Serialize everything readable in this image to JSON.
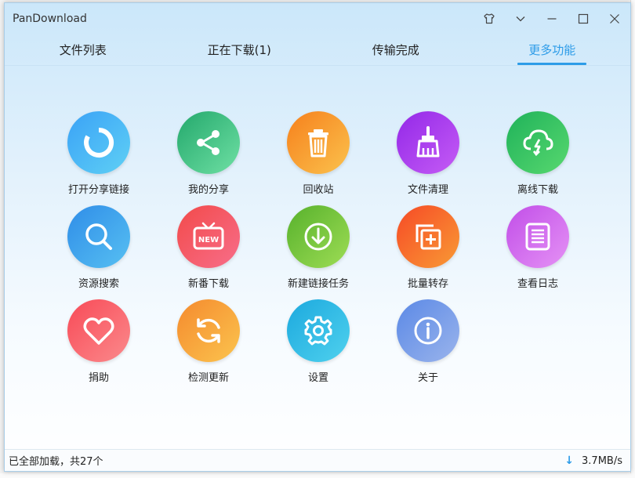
{
  "window": {
    "title": "PanDownload"
  },
  "tabs": [
    {
      "label": "文件列表"
    },
    {
      "label": "正在下载(1)"
    },
    {
      "label": "传输完成"
    },
    {
      "label": "更多功能"
    }
  ],
  "features": [
    {
      "label": "打开分享链接",
      "icon": "circle-arc-icon",
      "color_from": "#3aa2f6",
      "color_to": "#5fd0f5"
    },
    {
      "label": "我的分享",
      "icon": "share-icon",
      "color_from": "#23a86c",
      "color_to": "#6fe0a4"
    },
    {
      "label": "回收站",
      "icon": "trash-icon",
      "color_from": "#f6801c",
      "color_to": "#fbc24d"
    },
    {
      "label": "文件清理",
      "icon": "broom-icon",
      "color_from": "#9328e8",
      "color_to": "#c55cf5"
    },
    {
      "label": "离线下载",
      "icon": "cloud-download-icon",
      "color_from": "#1fb25a",
      "color_to": "#58d86f"
    },
    {
      "label": "资源搜索",
      "icon": "search-icon",
      "color_from": "#2f8de8",
      "color_to": "#57c0f2"
    },
    {
      "label": "新番下载",
      "icon": "tv-new-icon",
      "color_from": "#f24a4a",
      "color_to": "#f86e8a"
    },
    {
      "label": "新建链接任务",
      "icon": "download-circle-icon",
      "color_from": "#57b12c",
      "color_to": "#9edd55"
    },
    {
      "label": "批量转存",
      "icon": "copy-plus-icon",
      "color_from": "#f64a26",
      "color_to": "#f99a35"
    },
    {
      "label": "查看日志",
      "icon": "log-list-icon",
      "color_from": "#c14ee8",
      "color_to": "#e592f5"
    },
    {
      "label": "捐助",
      "icon": "heart-icon",
      "color_from": "#f84a57",
      "color_to": "#fb8a8c"
    },
    {
      "label": "检测更新",
      "icon": "refresh-icon",
      "color_from": "#f58a2e",
      "color_to": "#fbc44e"
    },
    {
      "label": "设置",
      "icon": "gear-icon",
      "color_from": "#1ca9de",
      "color_to": "#4fd1ee"
    },
    {
      "label": "关于",
      "icon": "info-icon",
      "color_from": "#5b89e6",
      "color_to": "#9ab4ec"
    }
  ],
  "status": {
    "text": "已全部加载，共27个",
    "speed": "3.7MB/s"
  }
}
